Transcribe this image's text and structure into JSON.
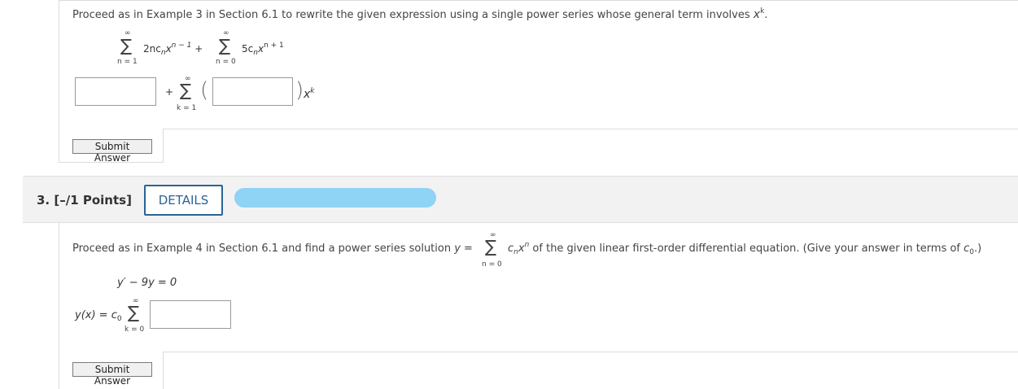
{
  "q2": {
    "prompt_a": "Proceed as in Example 3 in Section 6.1 to rewrite the given expression using a single power series whose general term involves ",
    "prompt_x": "x",
    "prompt_k": "k",
    "prompt_end": ".",
    "expr": {
      "sum1_upper": "∞",
      "sum1_lower": "n = 1",
      "term1_coef": "2nc",
      "term1_sub": "n",
      "term1_x": "x",
      "term1_pow": "n − 1",
      "plus": "+",
      "sum2_upper": "∞",
      "sum2_lower": "n = 0",
      "term2_coef": "5c",
      "term2_sub": "n",
      "term2_x": "x",
      "term2_pow": "n + 1"
    },
    "answer": {
      "plus": "+",
      "sum_upper": "∞",
      "sum_lower": "k = 1",
      "open_paren": "(",
      "close_paren": ")",
      "x": "x",
      "pow": "k"
    },
    "submit_label": "Submit Answer"
  },
  "q3": {
    "title": "3.  [–/1 Points]",
    "details_label": "DETAILS",
    "prompt_a": "Proceed as in Example 4 in Section 6.1 and find a power series solution ",
    "prompt_y": "y",
    "prompt_eq": " = ",
    "sum_upper": "∞",
    "sum_lower": "n = 0",
    "term_c": "c",
    "term_sub": "n",
    "term_x": "x",
    "term_pow": "n",
    "prompt_b": "  of the given linear first-order differential equation. (Give your answer in terms of ",
    "prompt_c0": "c",
    "prompt_c0_sub": "0",
    "prompt_end": ".)",
    "ode": "y′ − 9y = 0",
    "solution_lhs": "y(x) = c",
    "solution_sub": "0",
    "sol_sum_upper": "∞",
    "sol_sum_lower": "k = 0",
    "submit_label": "Submit Answer"
  },
  "colors": {
    "details_border": "#2a6496",
    "redaction": "#8fd3f5",
    "header_bg": "#f2f2f2"
  }
}
